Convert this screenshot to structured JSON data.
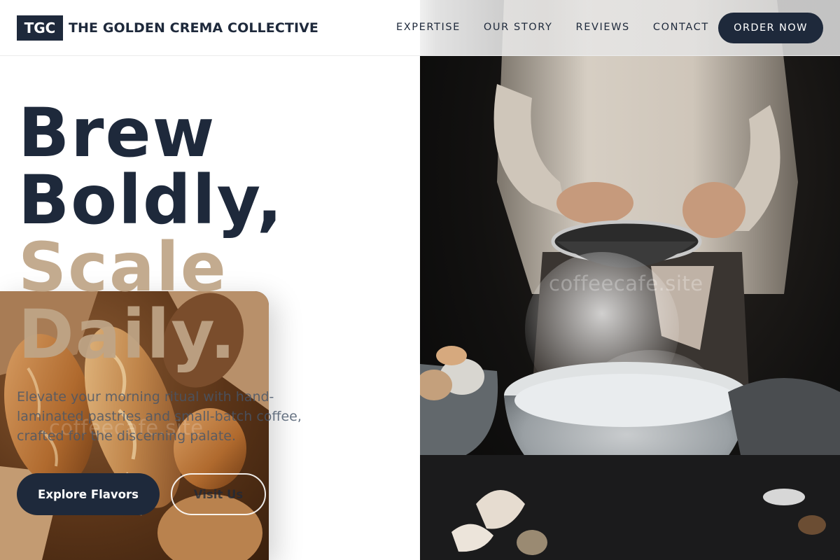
{
  "brand": {
    "logo": "TGC",
    "name": "THE GOLDEN CREMA COLLECTIVE"
  },
  "nav": {
    "items": [
      {
        "label": "EXPERTISE"
      },
      {
        "label": "OUR STORY"
      },
      {
        "label": "REVIEWS"
      },
      {
        "label": "CONTACT"
      }
    ],
    "cta": "ORDER NOW"
  },
  "hero": {
    "headline": {
      "line1": "Brew",
      "line2": "Boldly,",
      "line3": "Scale",
      "line4": "Daily."
    },
    "subtext": "Elevate your morning ritual with hand-laminated pastries and small-batch coffee, crafted for the discerning palate.",
    "primary_button": "Explore Flavors",
    "secondary_button": "Visit Us"
  },
  "watermarks": {
    "right": "coffeecafe.site",
    "left": "coffeecafe.site"
  },
  "colors": {
    "navy": "#1e293b",
    "tan": "#bea587",
    "white": "#ffffff",
    "muted": "#475569"
  }
}
